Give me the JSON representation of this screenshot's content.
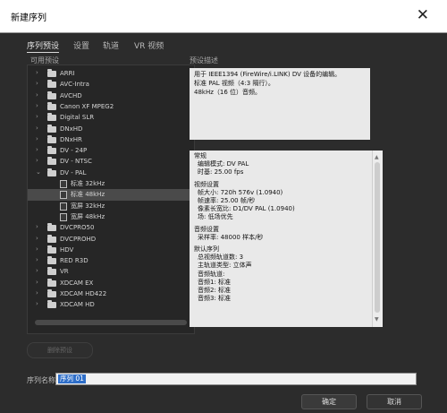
{
  "window": {
    "title": "新建序列",
    "close_glyph": "✕"
  },
  "tabs": [
    {
      "label": "序列预设",
      "active": true
    },
    {
      "label": "设置",
      "active": false
    },
    {
      "label": "轨道",
      "active": false
    },
    {
      "label": "VR 视频",
      "active": false
    }
  ],
  "available_presets": {
    "label": "可用预设",
    "tree": [
      {
        "label": "ARRI",
        "type": "folder",
        "expanded": false
      },
      {
        "label": "AVC-Intra",
        "type": "folder",
        "expanded": false
      },
      {
        "label": "AVCHD",
        "type": "folder",
        "expanded": false
      },
      {
        "label": "Canon XF MPEG2",
        "type": "folder",
        "expanded": false
      },
      {
        "label": "Digital SLR",
        "type": "folder",
        "expanded": false
      },
      {
        "label": "DNxHD",
        "type": "folder",
        "expanded": false
      },
      {
        "label": "DNxHR",
        "type": "folder",
        "expanded": false
      },
      {
        "label": "DV - 24P",
        "type": "folder",
        "expanded": false
      },
      {
        "label": "DV - NTSC",
        "type": "folder",
        "expanded": false
      },
      {
        "label": "DV - PAL",
        "type": "folder",
        "expanded": true
      },
      {
        "label": "标准 32kHz",
        "type": "preset",
        "selected": false
      },
      {
        "label": "标准 48kHz",
        "type": "preset",
        "selected": true
      },
      {
        "label": "宽屏 32kHz",
        "type": "preset",
        "selected": false
      },
      {
        "label": "宽屏 48kHz",
        "type": "preset",
        "selected": false
      },
      {
        "label": "DVCPRO50",
        "type": "folder",
        "expanded": false
      },
      {
        "label": "DVCPROHD",
        "type": "folder",
        "expanded": false
      },
      {
        "label": "HDV",
        "type": "folder",
        "expanded": false
      },
      {
        "label": "RED R3D",
        "type": "folder",
        "expanded": false
      },
      {
        "label": "VR",
        "type": "folder",
        "expanded": false
      },
      {
        "label": "XDCAM EX",
        "type": "folder",
        "expanded": false
      },
      {
        "label": "XDCAM HD422",
        "type": "folder",
        "expanded": false
      },
      {
        "label": "XDCAM HD",
        "type": "folder",
        "expanded": false
      }
    ]
  },
  "delete_preset_label": "删除预设",
  "description": {
    "label": "预设描述",
    "summary": [
      "用于 IEEE1394 (FireWire/i.LINK) DV 设备的编辑。",
      "标准 PAL 视频（4:3 隔行）。",
      "48kHz（16 位）音频。"
    ],
    "details": [
      {
        "heading": "常规",
        "lines": [
          "编辑模式: DV PAL",
          "时基: 25.00 fps"
        ]
      },
      {
        "heading": "视频设置",
        "lines": [
          "帧大小: 720h 576v (1.0940)",
          "帧速率: 25.00 帧/秒",
          "像素长宽比: D1/DV PAL (1.0940)",
          "场: 低场优先"
        ]
      },
      {
        "heading": "音频设置",
        "lines": [
          "采样率: 48000 样本/秒"
        ]
      },
      {
        "heading": "默认序列",
        "lines": [
          "总视频轨道数: 3",
          "主轨道类型: 立体声",
          "音频轨道:",
          "音频1: 标准",
          "音频2: 标准",
          "音频3: 标准"
        ]
      }
    ]
  },
  "sequence_name": {
    "label": "序列名称:",
    "value": "序列 01"
  },
  "buttons": {
    "ok": "确定",
    "cancel": "取消"
  },
  "icons": {
    "folder": "folder-icon",
    "preset": "file-icon",
    "collapsed": "›",
    "expanded": "⌄"
  }
}
